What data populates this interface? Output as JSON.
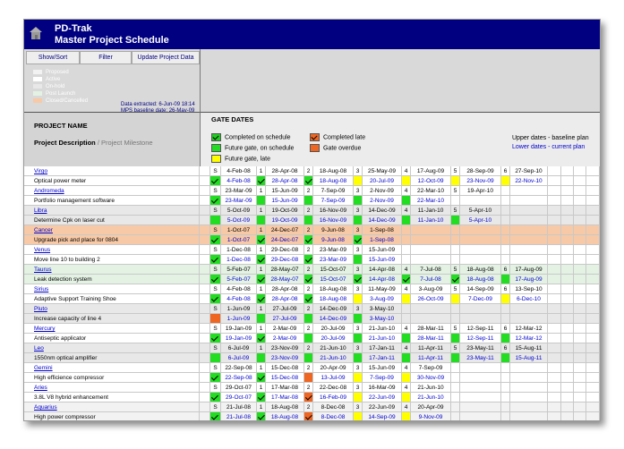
{
  "app": {
    "title1": "PD-Trak",
    "title2": "Master Project Schedule"
  },
  "toolbar": {
    "show_sort": "Show/Sort",
    "filter": "Filter",
    "update": "Update Project Data"
  },
  "legend": [
    {
      "label": "Proposed",
      "color": "#f2f2f2"
    },
    {
      "label": "Active",
      "color": "#ffffff"
    },
    {
      "label": "On-hold",
      "color": "#e8e8e8"
    },
    {
      "label": "Post Launch",
      "color": "#e4f2e4"
    },
    {
      "label": "Closed/Cancelled",
      "color": "#f7c9a6"
    }
  ],
  "info": {
    "extracted": "Data extracted: 6-Jun-09 18:14",
    "baseline": "MPS baseline date: 26-May-09"
  },
  "headers": {
    "project_name": "PROJECT NAME",
    "project_description": "Project Description",
    "project_milestone": "/ Project Milestone",
    "gate_dates": "GATE DATES",
    "upper_note": "Upper dates - baseline plan",
    "lower_note": "Lower dates - current plan"
  },
  "gate_key": [
    {
      "label": "Completed on schedule",
      "color": "#22cc22",
      "tick": true
    },
    {
      "label": "Completed late",
      "color": "#ee6622",
      "tick": true
    },
    {
      "label": "Future gate, on schedule",
      "color": "#22dd22",
      "tick": false
    },
    {
      "label": "Gate overdue",
      "color": "#ee6622",
      "tick": false
    },
    {
      "label": "Future gate, late",
      "color": "#ffff00",
      "tick": false
    }
  ],
  "colors": {
    "green": "#22dd22",
    "orange": "#ee6622",
    "yellow": "#ffff00",
    "title_bar": "#000080"
  },
  "projects": [
    {
      "name": "Virgo",
      "desc": "Optical power meter",
      "bg": "#ffffff",
      "gates": [
        {
          "n": "S",
          "base": "4-Feb-08",
          "cur": "4-Feb-08",
          "st": "on_time"
        },
        {
          "n": "1",
          "base": "28-Apr-08",
          "cur": "28-Apr-08",
          "st": "on_time"
        },
        {
          "n": "2",
          "base": "18-Aug-08",
          "cur": "18-Aug-08",
          "st": "on_time"
        },
        {
          "n": "3",
          "base": "25-May-09",
          "cur": "20-Jul-09",
          "st": "future_late"
        },
        {
          "n": "4",
          "base": "17-Aug-09",
          "cur": "12-Oct-09",
          "st": "future_late"
        },
        {
          "n": "5",
          "base": "28-Sep-09",
          "cur": "23-Nov-09",
          "st": "future_late"
        },
        {
          "n": "6",
          "base": "27-Sep-10",
          "cur": "22-Nov-10",
          "st": "future_late"
        }
      ]
    },
    {
      "name": "Andromeda",
      "desc": "Portfolio management software",
      "bg": "#ffffff",
      "gates": [
        {
          "n": "S",
          "base": "23-Mar-09",
          "cur": "23-Mar-09",
          "st": "on_time"
        },
        {
          "n": "1",
          "base": "15-Jun-09",
          "cur": "15-Jun-09",
          "st": "future_on"
        },
        {
          "n": "2",
          "base": "7-Sep-09",
          "cur": "7-Sep-09",
          "st": "future_on"
        },
        {
          "n": "3",
          "base": "2-Nov-09",
          "cur": "2-Nov-09",
          "st": "future_on"
        },
        {
          "n": "4",
          "base": "22-Mar-10",
          "cur": "22-Mar-10",
          "st": "future_on"
        },
        {
          "n": "5",
          "base": "19-Apr-10",
          "cur": "",
          "st": "none"
        },
        {
          "n": "",
          "base": "",
          "cur": "",
          "st": "none"
        }
      ]
    },
    {
      "name": "Libra",
      "desc": "Determine Cpk on laser cut",
      "bg": "#e8e8e8",
      "gates": [
        {
          "n": "S",
          "base": "5-Oct-09",
          "cur": "5-Oct-09",
          "st": "future_on"
        },
        {
          "n": "1",
          "base": "19-Oct-09",
          "cur": "19-Oct-09",
          "st": "future_on"
        },
        {
          "n": "2",
          "base": "16-Nov-09",
          "cur": "16-Nov-09",
          "st": "future_on"
        },
        {
          "n": "3",
          "base": "14-Dec-09",
          "cur": "14-Dec-09",
          "st": "future_on"
        },
        {
          "n": "4",
          "base": "11-Jan-10",
          "cur": "11-Jan-10",
          "st": "future_on"
        },
        {
          "n": "5",
          "base": "5-Apr-10",
          "cur": "5-Apr-10",
          "st": "future_on"
        },
        {
          "n": "",
          "base": "",
          "cur": "",
          "st": "none"
        }
      ]
    },
    {
      "name": "Cancer",
      "desc": "Upgrade pick and place for 0804",
      "bg": "#f7c9a6",
      "gates": [
        {
          "n": "S",
          "base": "1-Oct-07",
          "cur": "1-Oct-07",
          "st": "on_time"
        },
        {
          "n": "1",
          "base": "24-Dec-07",
          "cur": "24-Dec-07",
          "st": "on_time"
        },
        {
          "n": "2",
          "base": "9-Jun-08",
          "cur": "9-Jun-08",
          "st": "on_time"
        },
        {
          "n": "3",
          "base": "1-Sep-08",
          "cur": "1-Sep-08",
          "st": "on_time"
        },
        {
          "n": "",
          "base": "",
          "cur": "",
          "st": "none"
        },
        {
          "n": "",
          "base": "",
          "cur": "",
          "st": "none"
        },
        {
          "n": "",
          "base": "",
          "cur": "",
          "st": "none"
        }
      ]
    },
    {
      "name": "Venus",
      "desc": "Move line 10 to building 2",
      "bg": "#ffffff",
      "gates": [
        {
          "n": "S",
          "base": "1-Dec-08",
          "cur": "1-Dec-08",
          "st": "on_time"
        },
        {
          "n": "1",
          "base": "29-Dec-08",
          "cur": "29-Dec-08",
          "st": "on_time"
        },
        {
          "n": "2",
          "base": "23-Mar-09",
          "cur": "23-Mar-09",
          "st": "on_time"
        },
        {
          "n": "3",
          "base": "15-Jun-09",
          "cur": "15-Jun-09",
          "st": "future_on"
        },
        {
          "n": "",
          "base": "",
          "cur": "",
          "st": "none"
        },
        {
          "n": "",
          "base": "",
          "cur": "",
          "st": "none"
        },
        {
          "n": "",
          "base": "",
          "cur": "",
          "st": "none"
        }
      ]
    },
    {
      "name": "Taurus",
      "desc": "Leak detection system",
      "bg": "#e4f2e4",
      "gates": [
        {
          "n": "S",
          "base": "5-Feb-07",
          "cur": "5-Feb-07",
          "st": "on_time"
        },
        {
          "n": "1",
          "base": "28-May-07",
          "cur": "28-May-07",
          "st": "on_time"
        },
        {
          "n": "2",
          "base": "15-Oct-07",
          "cur": "15-Oct-07",
          "st": "on_time"
        },
        {
          "n": "3",
          "base": "14-Apr-08",
          "cur": "14-Apr-08",
          "st": "on_time"
        },
        {
          "n": "4",
          "base": "7-Jul-08",
          "cur": "7-Jul-08",
          "st": "on_time"
        },
        {
          "n": "5",
          "base": "18-Aug-08",
          "cur": "18-Aug-08",
          "st": "on_time"
        },
        {
          "n": "6",
          "base": "17-Aug-09",
          "cur": "17-Aug-09",
          "st": "future_on"
        }
      ]
    },
    {
      "name": "Sirius",
      "desc": "Adaptive Support Training Shoe",
      "bg": "#ffffff",
      "gates": [
        {
          "n": "S",
          "base": "4-Feb-08",
          "cur": "4-Feb-08",
          "st": "on_time"
        },
        {
          "n": "1",
          "base": "28-Apr-08",
          "cur": "28-Apr-08",
          "st": "on_time"
        },
        {
          "n": "2",
          "base": "18-Aug-08",
          "cur": "18-Aug-08",
          "st": "on_time"
        },
        {
          "n": "3",
          "base": "11-May-09",
          "cur": "3-Aug-09",
          "st": "future_late"
        },
        {
          "n": "4",
          "base": "3-Aug-09",
          "cur": "26-Oct-09",
          "st": "future_late"
        },
        {
          "n": "5",
          "base": "14-Sep-09",
          "cur": "7-Dec-09",
          "st": "future_late"
        },
        {
          "n": "6",
          "base": "13-Sep-10",
          "cur": "6-Dec-10",
          "st": "future_late"
        }
      ]
    },
    {
      "name": "Pluto",
      "desc": "Increase capacity of line 4",
      "bg": "#e8e8e8",
      "gates": [
        {
          "n": "S",
          "base": "1-Jun-09",
          "cur": "1-Jun-09",
          "st": "overdue"
        },
        {
          "n": "1",
          "base": "27-Jul-09",
          "cur": "27-Jul-09",
          "st": "future_on"
        },
        {
          "n": "2",
          "base": "14-Dec-09",
          "cur": "14-Dec-09",
          "st": "future_on"
        },
        {
          "n": "3",
          "base": "3-May-10",
          "cur": "3-May-10",
          "st": "future_on"
        },
        {
          "n": "",
          "base": "",
          "cur": "",
          "st": "none"
        },
        {
          "n": "",
          "base": "",
          "cur": "",
          "st": "none"
        },
        {
          "n": "",
          "base": "",
          "cur": "",
          "st": "none"
        }
      ]
    },
    {
      "name": "Mercury",
      "desc": "Antiseptic applicator",
      "bg": "#ffffff",
      "gates": [
        {
          "n": "S",
          "base": "19-Jan-09",
          "cur": "19-Jan-09",
          "st": "on_time"
        },
        {
          "n": "1",
          "base": "2-Mar-09",
          "cur": "2-Mar-09",
          "st": "on_time"
        },
        {
          "n": "2",
          "base": "20-Jul-09",
          "cur": "20-Jul-09",
          "st": "future_on"
        },
        {
          "n": "3",
          "base": "21-Jun-10",
          "cur": "21-Jun-10",
          "st": "future_on"
        },
        {
          "n": "4",
          "base": "28-Mar-11",
          "cur": "28-Mar-11",
          "st": "future_on"
        },
        {
          "n": "5",
          "base": "12-Sep-11",
          "cur": "12-Sep-11",
          "st": "future_on"
        },
        {
          "n": "6",
          "base": "12-Mar-12",
          "cur": "12-Mar-12",
          "st": "future_on"
        }
      ]
    },
    {
      "name": "Leo",
      "desc": "1550nm optical amplifier",
      "bg": "#e8e8e8",
      "gates": [
        {
          "n": "S",
          "base": "6-Jul-09",
          "cur": "6-Jul-09",
          "st": "future_on"
        },
        {
          "n": "1",
          "base": "23-Nov-09",
          "cur": "23-Nov-09",
          "st": "future_on"
        },
        {
          "n": "2",
          "base": "21-Jun-10",
          "cur": "21-Jun-10",
          "st": "future_on"
        },
        {
          "n": "3",
          "base": "17-Jan-11",
          "cur": "17-Jan-11",
          "st": "future_on"
        },
        {
          "n": "4",
          "base": "11-Apr-11",
          "cur": "11-Apr-11",
          "st": "future_on"
        },
        {
          "n": "5",
          "base": "23-May-11",
          "cur": "23-May-11",
          "st": "future_on"
        },
        {
          "n": "6",
          "base": "15-Aug-11",
          "cur": "15-Aug-11",
          "st": "future_on"
        }
      ]
    },
    {
      "name": "Gemini",
      "desc": "High efficience compressor",
      "bg": "#ffffff",
      "gates": [
        {
          "n": "S",
          "base": "22-Sep-08",
          "cur": "22-Sep-08",
          "st": "on_time"
        },
        {
          "n": "1",
          "base": "15-Dec-08",
          "cur": "15-Dec-08",
          "st": "on_time"
        },
        {
          "n": "2",
          "base": "20-Apr-09",
          "cur": "13-Jul-09",
          "st": "overdue"
        },
        {
          "n": "3",
          "base": "15-Jun-09",
          "cur": "7-Sep-09",
          "st": "future_late"
        },
        {
          "n": "4",
          "base": "7-Sep-09",
          "cur": "30-Nov-09",
          "st": "future_late"
        },
        {
          "n": "",
          "base": "",
          "cur": "",
          "st": "none"
        },
        {
          "n": "",
          "base": "",
          "cur": "",
          "st": "none"
        }
      ]
    },
    {
      "name": "Aries",
      "desc": "3.8L V8 hybrid enhancement",
      "bg": "#ffffff",
      "gates": [
        {
          "n": "S",
          "base": "29-Oct-07",
          "cur": "29-Oct-07",
          "st": "on_time"
        },
        {
          "n": "1",
          "base": "17-Mar-08",
          "cur": "17-Mar-08",
          "st": "on_time"
        },
        {
          "n": "2",
          "base": "22-Dec-08",
          "cur": "16-Feb-09",
          "st": "late_done"
        },
        {
          "n": "3",
          "base": "16-Mar-09",
          "cur": "22-Jun-09",
          "st": "future_late"
        },
        {
          "n": "4",
          "base": "21-Jun-10",
          "cur": "21-Jun-10",
          "st": "future_late"
        },
        {
          "n": "",
          "base": "",
          "cur": "",
          "st": "none"
        },
        {
          "n": "",
          "base": "",
          "cur": "",
          "st": "none"
        }
      ]
    },
    {
      "name": "Aquarius",
      "desc": "High power compressor",
      "bg": "#f2f2f2",
      "gates": [
        {
          "n": "S",
          "base": "21-Jul-08",
          "cur": "21-Jul-08",
          "st": "on_time"
        },
        {
          "n": "1",
          "base": "18-Aug-08",
          "cur": "18-Aug-08",
          "st": "on_time"
        },
        {
          "n": "2",
          "base": "8-Dec-08",
          "cur": "8-Dec-08",
          "st": "late_done"
        },
        {
          "n": "3",
          "base": "22-Jun-09",
          "cur": "14-Sep-09",
          "st": "future_late"
        },
        {
          "n": "4",
          "base": "20-Apr-09",
          "cur": "9-Nov-09",
          "st": "future_late"
        },
        {
          "n": "",
          "base": "",
          "cur": "",
          "st": "none"
        },
        {
          "n": "",
          "base": "",
          "cur": "",
          "st": "none"
        }
      ]
    }
  ]
}
